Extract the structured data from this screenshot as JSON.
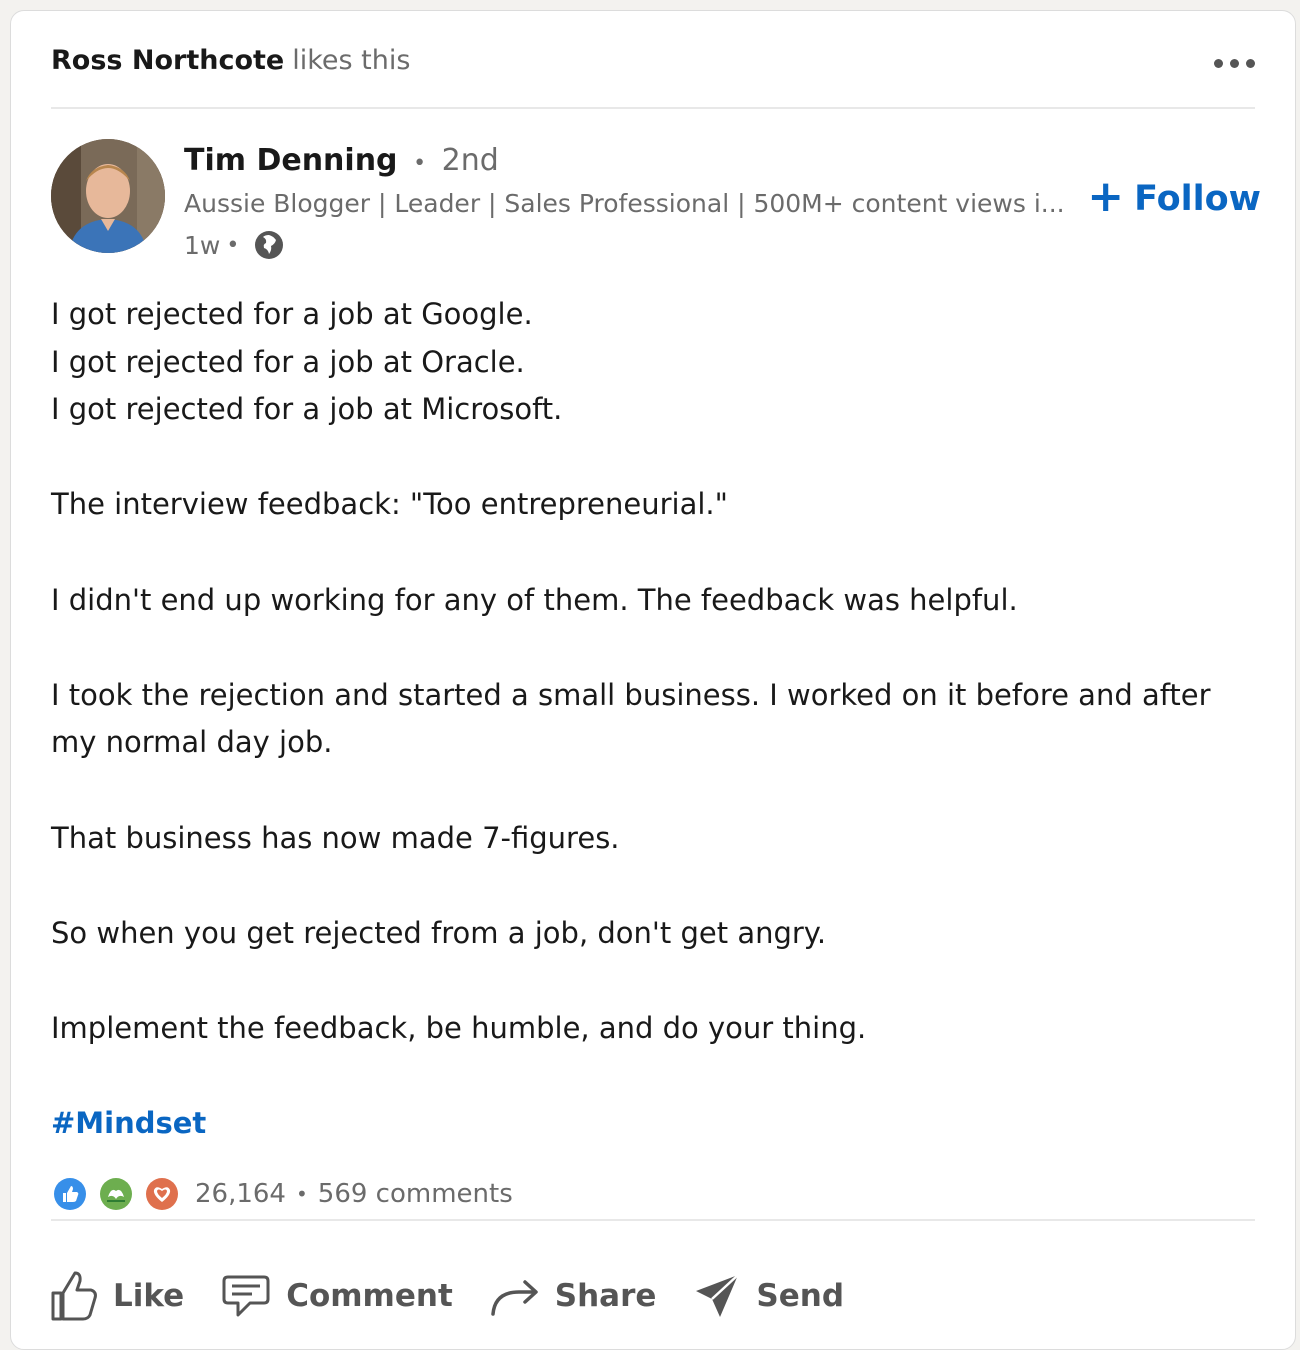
{
  "header": {
    "liker_name": "Ross Northcote",
    "likes_text": "likes this",
    "more_icon": "ellipsis-icon"
  },
  "actor": {
    "name": "Tim Denning",
    "degree": "2nd",
    "headline": "Aussie Blogger | Leader | Sales Professional | 500M+ content views i...",
    "time": "1w",
    "visibility_icon": "globe-icon",
    "follow_label": "Follow"
  },
  "post": {
    "lines": [
      "I got rejected for a job at Google.",
      "I got rejected for a job at Oracle.",
      "I got rejected for a job at Microsoft.",
      "The interview feedback: \"Too entrepreneurial.\"",
      "I didn't end up working for any of them. The feedback was helpful.",
      "I took the rejection and started a small business. I worked on it before and after",
      "my normal day job.",
      "That business has now made 7-figures.",
      "So when you get rejected from a job, don't get angry.",
      "Implement the feedback, be humble, and do your thing."
    ],
    "hashtag": "#Mindset"
  },
  "social_counts": {
    "reactions": "26,164",
    "comments": "569 comments",
    "reaction_icons": [
      "like-reaction-icon",
      "support-reaction-icon",
      "love-reaction-icon"
    ]
  },
  "actions": {
    "like": "Like",
    "comment": "Comment",
    "share": "Share",
    "send": "Send"
  },
  "colors": {
    "accent": "#0a66c2",
    "muted_text": "#6b6b6b",
    "primary_text": "#191919"
  }
}
